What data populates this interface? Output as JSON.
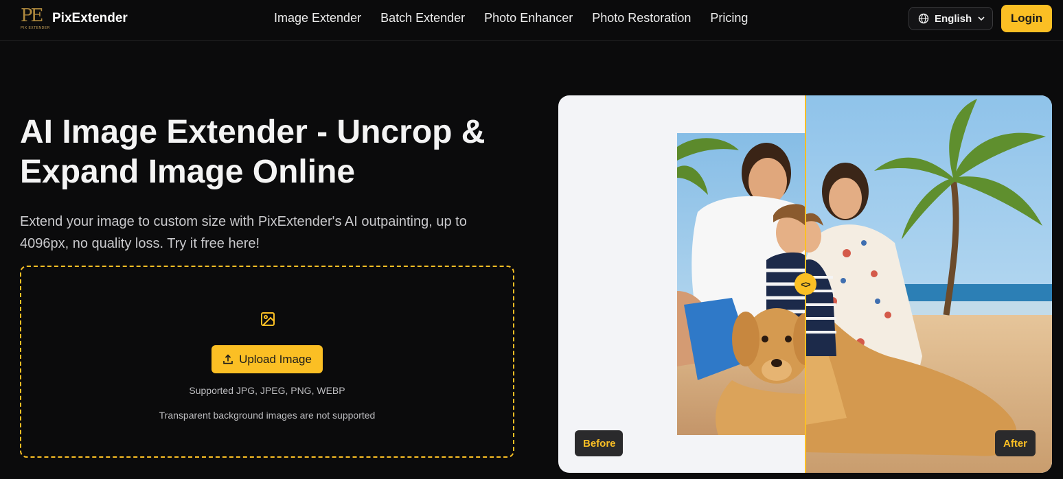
{
  "header": {
    "logo_mark": "PE",
    "logo_sub": "PIX EXTENDER",
    "brand": "PixExtender",
    "nav": [
      {
        "label": "Image Extender"
      },
      {
        "label": "Batch Extender"
      },
      {
        "label": "Photo Enhancer"
      },
      {
        "label": "Photo Restoration"
      },
      {
        "label": "Pricing"
      }
    ],
    "language": "English",
    "login": "Login"
  },
  "hero": {
    "title": "AI Image Extender - Uncrop & Expand Image Online",
    "subtitle": "Extend your image to custom size with PixExtender's AI outpainting, up to 4096px, no quality loss. Try it free here!"
  },
  "upload": {
    "button": "Upload Image",
    "formats": "Supported JPG, JPEG, PNG, WEBP",
    "note": "Transparent background images are not supported"
  },
  "compare": {
    "before_label": "Before",
    "after_label": "After",
    "handle_glyph": "<>"
  },
  "colors": {
    "accent": "#fbbf24",
    "background": "#0b0b0c",
    "panel_bg": "#f3f4f7"
  }
}
